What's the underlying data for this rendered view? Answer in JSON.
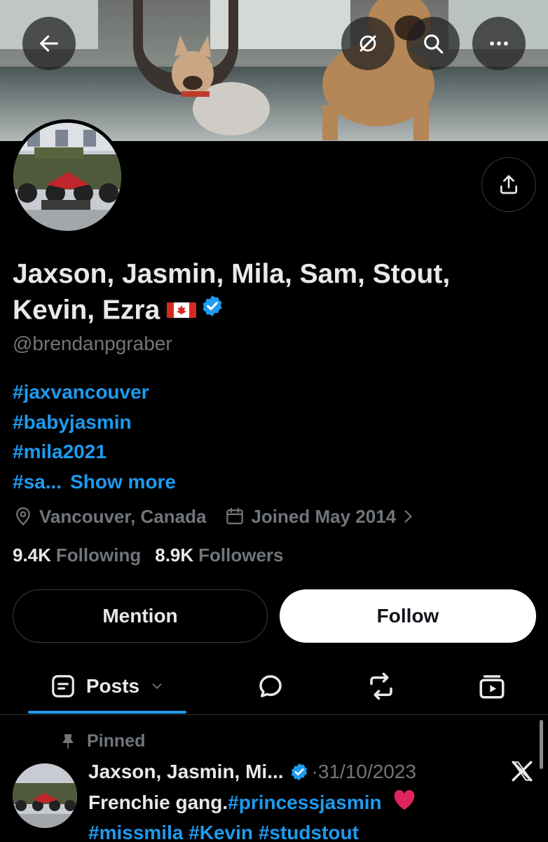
{
  "header": {
    "back_icon": "arrow-left-icon",
    "grok_icon": "grok-icon",
    "search_icon": "search-icon",
    "more_icon": "ellipsis-icon"
  },
  "profile": {
    "display_name": "Jaxson, Jasmin, Mila, Sam, Stout, Kevin, Ezra",
    "handle": "@brendanpgraber",
    "verified": true,
    "bio_lines": [
      "#jaxvancouver",
      "#babyjasmin",
      "#mila2021",
      "#sa..."
    ],
    "show_more": "Show more",
    "location": "Vancouver, Canada",
    "joined": "Joined May 2014",
    "following_count": "9.4K",
    "following_label": "Following",
    "followers_count": "8.9K",
    "followers_label": "Followers"
  },
  "actions": {
    "mention_label": "Mention",
    "follow_label": "Follow"
  },
  "tabs": {
    "posts_label": "Posts"
  },
  "post": {
    "pinned_label": "Pinned",
    "author": "Jaxson, Jasmin, Mi...",
    "date": "·31/10/2023",
    "text": "Frenchie gang.",
    "tag1": "#princessjasmin",
    "tag2": "#missmila",
    "tag3": "#Kevin",
    "tag4": "#studstout"
  },
  "colors": {
    "accent": "#1d9bf0",
    "background": "#000000",
    "secondary_text": "#71767b"
  }
}
